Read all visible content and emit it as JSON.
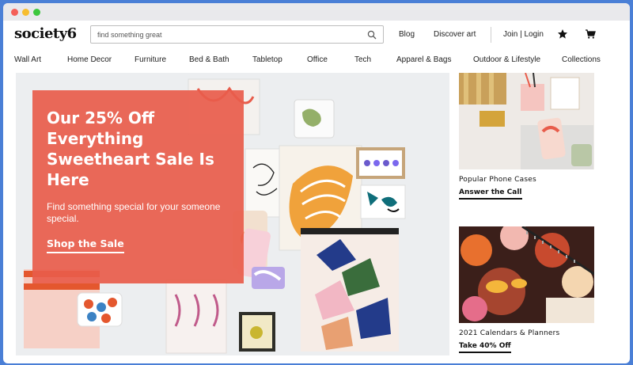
{
  "brand": {
    "logo": "society6"
  },
  "search": {
    "placeholder": "find something great"
  },
  "header_links": {
    "blog": "Blog",
    "discover": "Discover art",
    "account": "Join | Login"
  },
  "icons": {
    "search": "search-icon",
    "favorites": "star-icon",
    "cart": "cart-icon"
  },
  "nav": {
    "items": [
      "Wall Art",
      "Home Decor",
      "Furniture",
      "Bed & Bath",
      "Tabletop",
      "Office",
      "Tech",
      "Apparel & Bags",
      "Outdoor & Lifestyle",
      "Collections"
    ]
  },
  "hero": {
    "headline": "Our 25% Off Everything Sweetheart Sale Is Here",
    "subtext": "Find something special for your someone special.",
    "cta": "Shop the Sale",
    "panel_color": "#e85c4b"
  },
  "cards": [
    {
      "title": "Popular Phone Cases",
      "cta": "Answer the Call"
    },
    {
      "title": "2021 Calendars & Planners",
      "cta": "Take 40% Off"
    }
  ]
}
